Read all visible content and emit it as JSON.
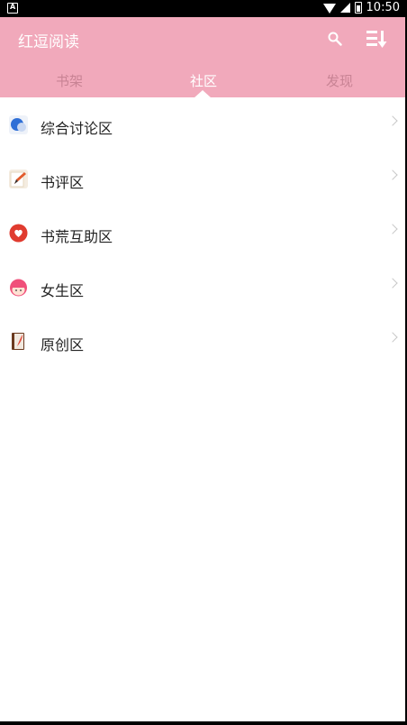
{
  "statusbar": {
    "time": "10:50",
    "left_icon_text": "A"
  },
  "app": {
    "title": "红逗阅读"
  },
  "tabs": [
    {
      "label": "书架"
    },
    {
      "label": "社区"
    },
    {
      "label": "发现"
    }
  ],
  "community": {
    "items": [
      {
        "label": "综合讨论区",
        "icon": "chat-bubble-icon"
      },
      {
        "label": "书评区",
        "icon": "pencil-note-icon"
      },
      {
        "label": "书荒互助区",
        "icon": "heart-badge-icon"
      },
      {
        "label": "女生区",
        "icon": "girl-face-icon"
      },
      {
        "label": "原创区",
        "icon": "book-quill-icon"
      }
    ]
  },
  "colors": {
    "appbar": "#f1a9bb",
    "tab_inactive": "#c88394",
    "tab_active": "#ffffff"
  }
}
